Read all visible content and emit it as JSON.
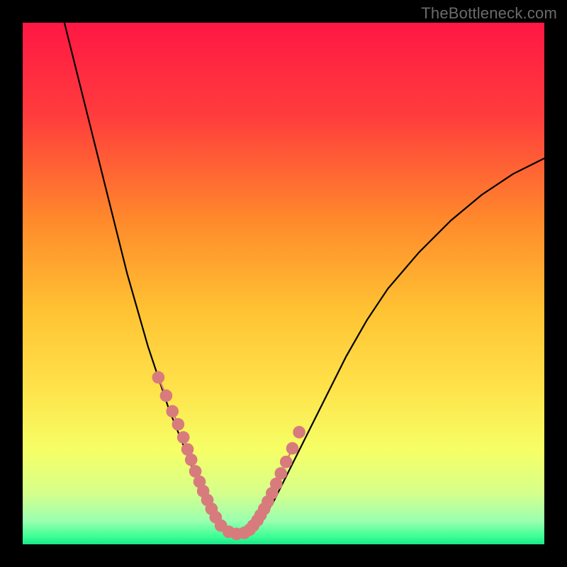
{
  "watermark": "TheBottleneck.com",
  "colors": {
    "frame": "#000000",
    "gradient_stops": [
      {
        "pos": 0.0,
        "color": "#ff1744"
      },
      {
        "pos": 0.18,
        "color": "#ff3d3d"
      },
      {
        "pos": 0.38,
        "color": "#ff8a2b"
      },
      {
        "pos": 0.55,
        "color": "#ffc233"
      },
      {
        "pos": 0.7,
        "color": "#ffe24a"
      },
      {
        "pos": 0.82,
        "color": "#f6ff66"
      },
      {
        "pos": 0.9,
        "color": "#d7ff8a"
      },
      {
        "pos": 0.955,
        "color": "#9bffb0"
      },
      {
        "pos": 0.985,
        "color": "#3dff94"
      },
      {
        "pos": 1.0,
        "color": "#19e88a"
      }
    ],
    "marker": "#d87b7d",
    "curve": "#000000"
  },
  "chart_data": {
    "type": "line",
    "title": "",
    "xlabel": "",
    "ylabel": "",
    "xlim": [
      0,
      100
    ],
    "ylim": [
      0,
      100
    ],
    "grid": false,
    "legend": false,
    "series": [
      {
        "name": "curve",
        "x": [
          8,
          10,
          12,
          14,
          16,
          18,
          20,
          22,
          24,
          26,
          28,
          30,
          32,
          34,
          35,
          36,
          37,
          38,
          39,
          40,
          42,
          44,
          46,
          48,
          50,
          54,
          58,
          62,
          66,
          70,
          76,
          82,
          88,
          94,
          100
        ],
        "y": [
          100,
          92,
          84,
          76,
          68,
          60,
          52,
          45,
          38,
          32,
          26,
          21,
          16,
          11,
          9,
          7,
          5,
          3.5,
          2.5,
          2,
          2,
          3,
          5,
          8,
          12,
          20,
          28,
          36,
          43,
          49,
          56,
          62,
          67,
          71,
          74
        ]
      }
    ],
    "marker_points": {
      "x": [
        26.0,
        27.5,
        28.7,
        29.8,
        30.8,
        31.6,
        32.3,
        33.1,
        33.9,
        34.6,
        35.4,
        36.2,
        37.0,
        38.0,
        39.5,
        41.0,
        42.5,
        43.5,
        44.2,
        45.0,
        45.6,
        46.3,
        47.0,
        47.8,
        48.6,
        49.5,
        50.5,
        51.7,
        53.0
      ],
      "y": [
        32.0,
        28.5,
        25.5,
        23.0,
        20.5,
        18.2,
        16.2,
        14.0,
        12.0,
        10.2,
        8.5,
        6.8,
        5.2,
        3.6,
        2.4,
        2.0,
        2.2,
        2.8,
        3.6,
        4.6,
        5.6,
        6.8,
        8.2,
        9.8,
        11.6,
        13.6,
        15.8,
        18.4,
        21.5
      ]
    }
  }
}
